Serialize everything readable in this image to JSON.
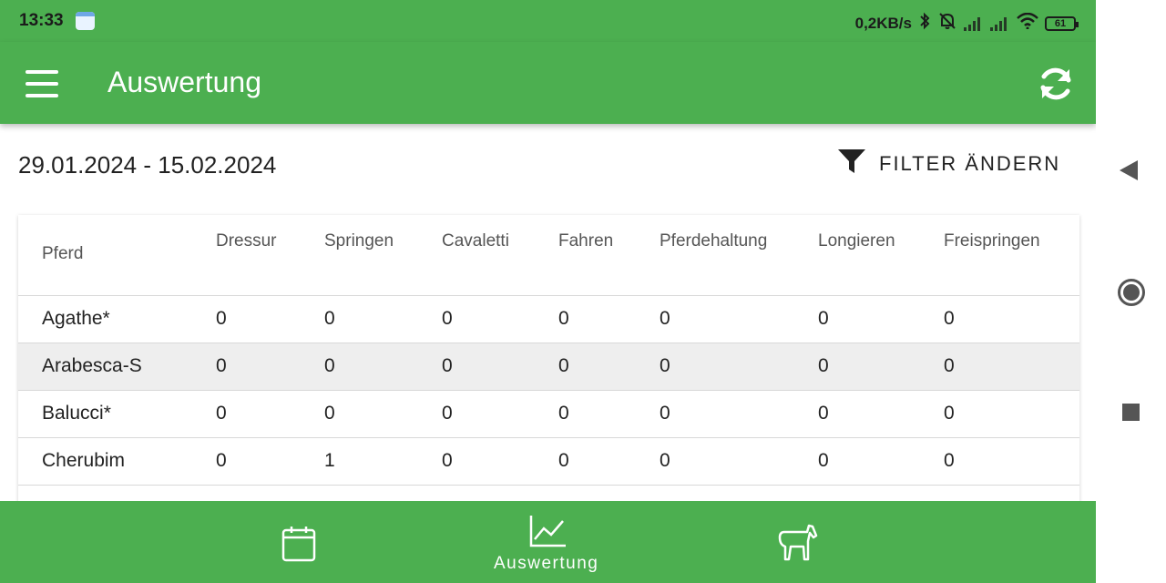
{
  "status": {
    "time": "13:33",
    "network_speed": "0,2KB/s",
    "battery": "61",
    "icons": [
      "calendar-icon",
      "bluetooth-icon",
      "mute-icon",
      "signal-icon",
      "signal-icon",
      "wifi-icon",
      "battery-icon"
    ]
  },
  "appbar": {
    "title": "Auswertung",
    "menu_icon": "menu-icon",
    "refresh_icon": "refresh-icon"
  },
  "range": {
    "dates": "29.01.2024 - 15.02.2024",
    "filter_label": "FILTER ÄNDERN",
    "filter_icon": "filter-icon"
  },
  "table": {
    "headers": [
      "Pferd",
      "Dressur",
      "Springen",
      "Cavaletti",
      "Fahren",
      "Pferdehaltung",
      "Longieren",
      "Freispringen"
    ],
    "rows": [
      [
        "Agathe*",
        "0",
        "0",
        "0",
        "0",
        "0",
        "0",
        "0"
      ],
      [
        "Arabesca-S",
        "0",
        "0",
        "0",
        "0",
        "0",
        "0",
        "0"
      ],
      [
        "Balucci*",
        "0",
        "0",
        "0",
        "0",
        "0",
        "0",
        "0"
      ],
      [
        "Cherubim",
        "0",
        "1",
        "0",
        "0",
        "0",
        "0",
        "0"
      ]
    ]
  },
  "bottomnav": {
    "items": [
      {
        "icon": "calendar-icon",
        "label": ""
      },
      {
        "icon": "chart-icon",
        "label": "Auswertung"
      },
      {
        "icon": "horse-icon",
        "label": ""
      }
    ]
  },
  "colors": {
    "primary": "#4caf50",
    "on_primary": "#ffffff",
    "row_alt": "#eeeeee"
  }
}
